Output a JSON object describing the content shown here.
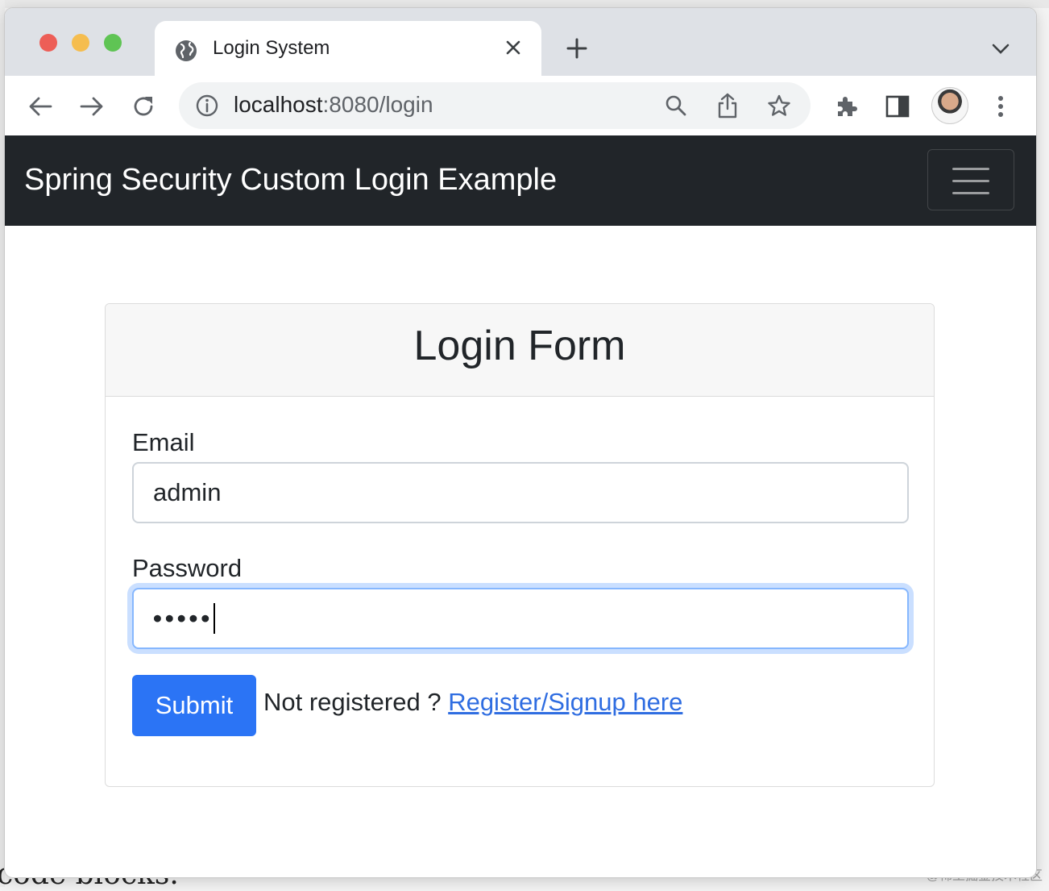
{
  "background": {
    "text": "code blocks.",
    "watermark": "@稀土掘金技术社区"
  },
  "browser": {
    "tab": {
      "title": "Login System",
      "icon": "globe-icon"
    },
    "address": {
      "host": "localhost",
      "rest": ":8080/login"
    },
    "icons": [
      "back-icon",
      "forward-icon",
      "reload-icon",
      "info-icon",
      "search-icon",
      "share-icon",
      "star-icon",
      "extensions-icon",
      "sidebar-icon",
      "avatar",
      "menu-icon"
    ]
  },
  "navbar": {
    "brand": "Spring Security Custom Login Example"
  },
  "login_form": {
    "title": "Login Form",
    "email_label": "Email",
    "email_value": "admin",
    "password_label": "Password",
    "password_masked": "•••••",
    "submit_label": "Submit",
    "not_registered": "Not registered ?",
    "register_link": "Register/Signup here"
  },
  "colors": {
    "navbar": "#212529",
    "primary": "#2b74f5",
    "link": "#2f6de1",
    "focus_ring": "#86b7fe"
  }
}
